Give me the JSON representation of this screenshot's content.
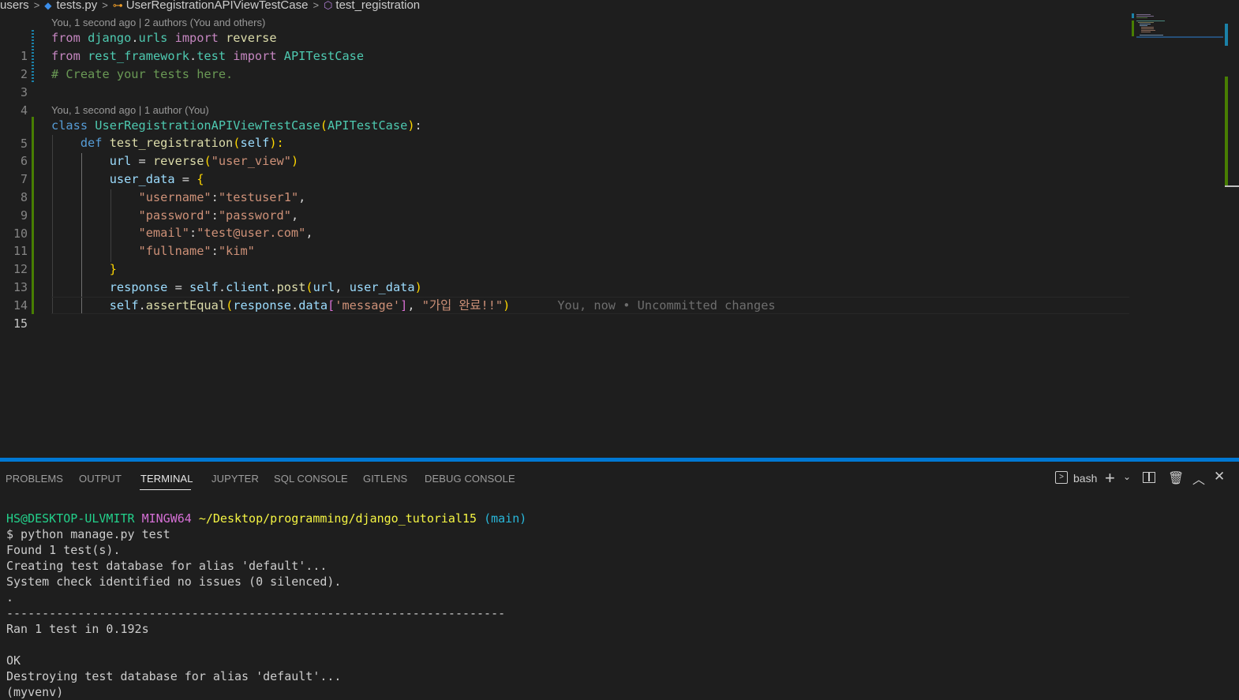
{
  "breadcrumb": {
    "folder": "users",
    "file": "tests.py",
    "class": "UserRegistrationAPIViewTestCase",
    "method": "test_registration"
  },
  "codelens": {
    "top": "You, 1 second ago | 2 authors (You and others)",
    "class": "You, 1 second ago | 1 author (You)"
  },
  "editor": {
    "line_numbers": [
      "1",
      "2",
      "3",
      "4",
      "5",
      "6",
      "7",
      "8",
      "9",
      "10",
      "11",
      "12",
      "13",
      "14",
      "15"
    ],
    "lines": {
      "l1": [
        "from",
        " ",
        "django",
        ".",
        "urls",
        " ",
        "import",
        " ",
        "reverse"
      ],
      "l2": [
        "from",
        " ",
        "rest_framework",
        ".",
        "test",
        " ",
        "import",
        " ",
        "APITestCase"
      ],
      "l3": [
        "# Create your tests here."
      ],
      "l5": [
        "class",
        " ",
        "UserRegistrationAPIViewTestCase",
        "(",
        "APITestCase",
        ")",
        ":"
      ],
      "l6": [
        "def",
        " ",
        "test_registration",
        "(",
        "self",
        "):"
      ],
      "l7": [
        "url",
        " = ",
        "reverse",
        "(",
        "\"user_view\"",
        ")"
      ],
      "l8": [
        "user_data",
        " = ",
        "{"
      ],
      "l9": [
        "\"username\"",
        ":",
        "\"testuser1\"",
        ","
      ],
      "l10": [
        "\"password\"",
        ":",
        "\"password\"",
        ","
      ],
      "l11": [
        "\"email\"",
        ":",
        "\"test@user.com\"",
        ","
      ],
      "l12": [
        "\"fullname\"",
        ":",
        "\"kim\""
      ],
      "l13": [
        "}"
      ],
      "l14": [
        "response",
        " = ",
        "self",
        ".",
        "client",
        ".",
        "post",
        "(",
        "url",
        ", ",
        "user_data",
        ")"
      ],
      "l15": [
        "self",
        ".",
        "assertEqual",
        "(",
        "response",
        ".",
        "data",
        "[",
        "'message'",
        "]",
        ", ",
        "\"가입 완료!!\"",
        ")"
      ]
    },
    "blame_inline": "You, now • Uncommitted changes"
  },
  "panel": {
    "tabs": [
      "PROBLEMS",
      "OUTPUT",
      "TERMINAL",
      "JUPYTER",
      "SQL CONSOLE",
      "GITLENS",
      "DEBUG CONSOLE"
    ],
    "active_tab": "TERMINAL",
    "shell_name": "bash"
  },
  "terminal": {
    "prompt_user": "HS@DESKTOP-ULVMITR",
    "prompt_env": "MINGW64",
    "prompt_path": "~/Desktop/programming/django_tutorial15",
    "prompt_branch": "(main)",
    "lines": [
      "$ python manage.py test",
      "Found 1 test(s).",
      "Creating test database for alias 'default'...",
      "System check identified no issues (0 silenced).",
      ".",
      "----------------------------------------------------------------------",
      "Ran 1 test in 0.192s",
      "",
      "OK",
      "Destroying test database for alias 'default'...",
      "(myvenv)"
    ]
  }
}
